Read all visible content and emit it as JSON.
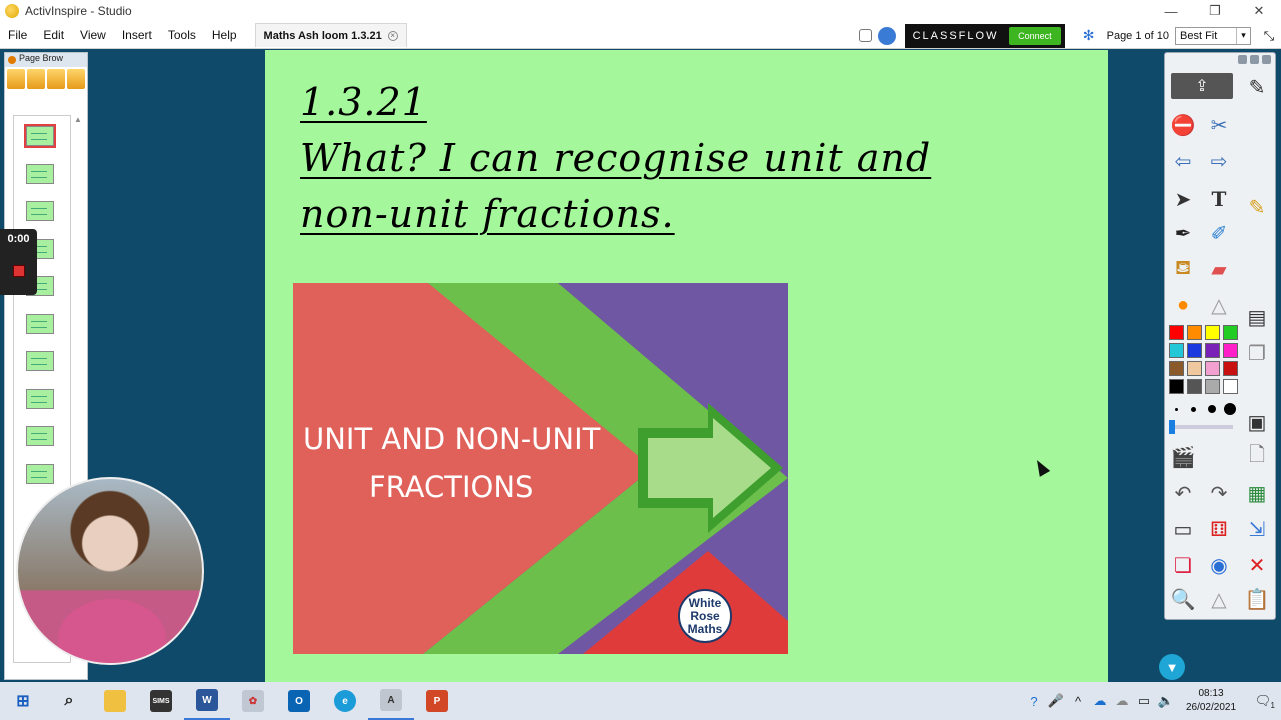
{
  "window": {
    "title": "ActivInspire - Studio",
    "controls": {
      "minimize": "—",
      "maximize": "❐",
      "close": "✕"
    }
  },
  "menu": {
    "items": [
      "File",
      "Edit",
      "View",
      "Insert",
      "Tools",
      "Help"
    ],
    "document_tab": "Maths Ash loom 1.3.21",
    "tab_close": "×"
  },
  "toolbar_right": {
    "classflow_logo": "CLASSFLOW",
    "classflow_connect": "Connect",
    "page_indicator": "Page 1 of 10",
    "zoom": "Best Fit",
    "zoom_arrow": "▾"
  },
  "page_browser": {
    "title": "Page Brow",
    "page_count": 10
  },
  "recorder": {
    "time": "0:00"
  },
  "slide": {
    "background": "#a4f79a",
    "date": "1.3.21",
    "objective_line1": "What? I can recognise unit and",
    "objective_line2": "non-unit fractions.",
    "graphic": {
      "title_line1": "UNIT AND NON-UNIT",
      "title_line2": "FRACTIONS",
      "logo_line1": "White",
      "logo_line2": "Rose",
      "logo_line3": "Maths",
      "colors": {
        "red": "#e0605a",
        "green": "#6cbf4a",
        "purple": "#6f57a3"
      }
    }
  },
  "toolbox": {
    "palette": [
      "#ff0000",
      "#ff8c00",
      "#ffff00",
      "#22cc22",
      "#22c8d8",
      "#1a3ae0",
      "#7a22b8",
      "#ff1fc8",
      "#8b5a2b",
      "#f0c8a0",
      "#f2a0d0",
      "#c81010",
      "#000000",
      "#555555",
      "#aaaaaa",
      "#ffffff"
    ]
  },
  "taskbar": {
    "time": "08:13",
    "date": "26/02/2021",
    "notification_count": "1"
  }
}
